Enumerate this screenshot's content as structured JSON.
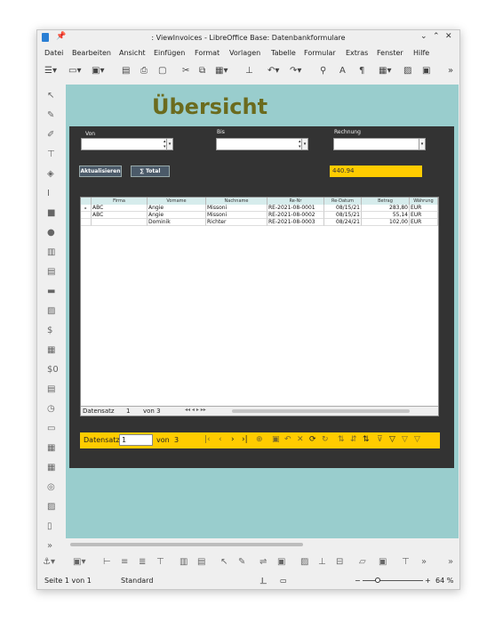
{
  "window": {
    "title": ": ViewInvoices - LibreOffice Base: Datenbankformulare"
  },
  "menu": [
    "Datei",
    "Bearbeiten",
    "Ansicht",
    "Einfügen",
    "Format",
    "Vorlagen",
    "Tabelle",
    "Formular",
    "Extras",
    "Fenster",
    "Hilfe"
  ],
  "form": {
    "heading": "Übersicht",
    "von_label": "Von",
    "bis_label": "Bis",
    "rechnung_label": "Rechnung",
    "refresh_label": "Aktualisieren",
    "total_button_label": "∑ Total",
    "total_value": "440.94"
  },
  "grid": {
    "columns": [
      "Firma",
      "Vorname",
      "Nachname",
      "Re-Nr",
      "Re-Datum",
      "Betrag",
      "Währung"
    ],
    "rows": [
      [
        "ABC",
        "Angie",
        "Missoni",
        "RE-2021-08-0001",
        "08/15/21",
        "283,80",
        "EUR"
      ],
      [
        "ABC",
        "Angie",
        "Missoni",
        "RE-2021-08-0002",
        "08/15/21",
        "55,14",
        "EUR"
      ],
      [
        "",
        "Dominik",
        "Richter",
        "RE-2021-08-0003",
        "08/24/21",
        "102,00",
        "EUR"
      ]
    ],
    "nav_label": "Datensatz",
    "nav_record": "1",
    "nav_of": "von 3"
  },
  "navbar": {
    "label": "Datensatz",
    "record": "1",
    "of_label": "von",
    "total": "3"
  },
  "status": {
    "page": "Seite 1 von 1",
    "style": "Standard",
    "zoom": "64 %"
  },
  "colors": {
    "background": "#99cdcd",
    "panel": "#333333",
    "accent": "#ffcc00",
    "heading": "#6b6b1e"
  }
}
